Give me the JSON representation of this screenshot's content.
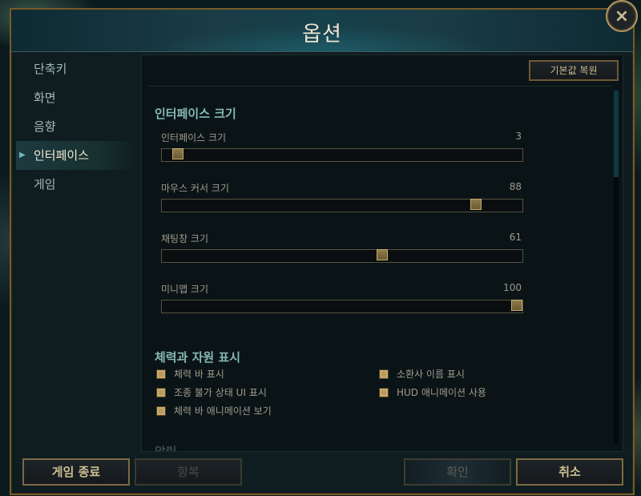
{
  "window": {
    "title": "옵션",
    "close_icon": "×"
  },
  "sidebar": {
    "items": [
      {
        "label": "단축키",
        "active": false
      },
      {
        "label": "화면",
        "active": false
      },
      {
        "label": "음향",
        "active": false
      },
      {
        "label": "인터페이스",
        "active": true
      },
      {
        "label": "게임",
        "active": false
      }
    ]
  },
  "content": {
    "restore_defaults_label": "기본값 복원",
    "interface_section": {
      "title": "인터페이스 크기",
      "sliders": [
        {
          "label": "인터페이스 크기",
          "value": "3",
          "fraction": 0.045
        },
        {
          "label": "마우스 커서 크기",
          "value": "88",
          "fraction": 0.87
        },
        {
          "label": "채팅창 크기",
          "value": "61",
          "fraction": 0.61
        },
        {
          "label": "미니맵 크기",
          "value": "100",
          "fraction": 0.985
        }
      ]
    },
    "health_section": {
      "title": "체력과 자원 표시",
      "checkboxes": [
        {
          "label": "체력 바 표시",
          "checked": true
        },
        {
          "label": "소환사 이름 표시",
          "checked": true
        },
        {
          "label": "조종 불가 상태 UI 표시",
          "checked": true
        },
        {
          "label": "HUD 애니메이션 사용",
          "checked": true
        },
        {
          "label": "체력 바 애니메이션 보기",
          "checked": true
        }
      ]
    },
    "next_section_title": "알림"
  },
  "footer": {
    "quit_label": "게임 종료",
    "surrender_label": "항복",
    "confirm_label": "확인",
    "cancel_label": "취소"
  },
  "colors": {
    "gold_border": "#785a28",
    "gold_text": "#cdbe91",
    "teal_heading": "#86b8b5",
    "checkbox_gold": "#b89a5a"
  }
}
